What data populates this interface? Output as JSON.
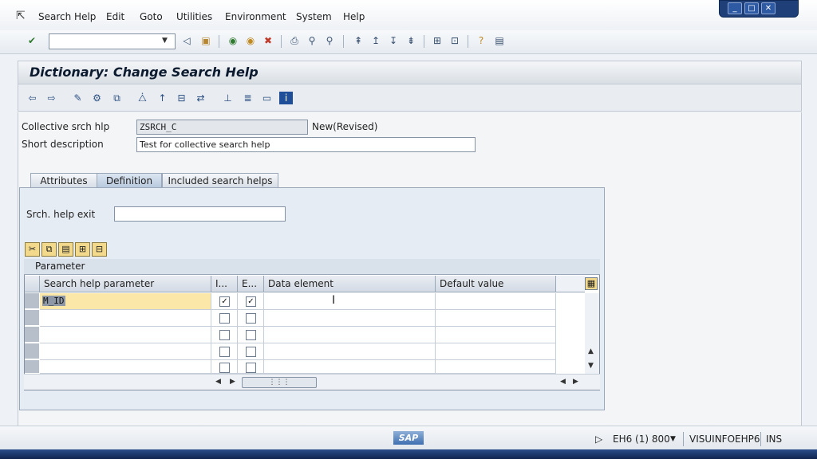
{
  "menu": {
    "items": [
      "Search Help",
      "Edit",
      "Goto",
      "Utilities",
      "Environment",
      "System",
      "Help"
    ]
  },
  "window_controls": {
    "minimize": "_",
    "maximize": "□",
    "close": "✕"
  },
  "toolbar": {
    "command_field_value": ""
  },
  "title": "Dictionary: Change Search Help",
  "form": {
    "collective_label": "Collective srch hlp",
    "collective_value": "ZSRCH_C",
    "status": "New(Revised)",
    "short_desc_label": "Short description",
    "short_desc_value": "Test for collective search help"
  },
  "tabs": [
    "Attributes",
    "Definition",
    "Included search helps"
  ],
  "definition": {
    "exit_label": "Srch. help exit",
    "exit_value": ""
  },
  "table": {
    "caption": "Parameter",
    "headers": [
      "Search help parameter",
      "I...",
      "E...",
      "Data element",
      "Default value"
    ],
    "rows": [
      {
        "param": "M_ID",
        "imp": true,
        "exp": true,
        "data_element": "",
        "default": ""
      },
      {
        "param": "",
        "imp": false,
        "exp": false,
        "data_element": "",
        "default": ""
      },
      {
        "param": "",
        "imp": false,
        "exp": false,
        "data_element": "",
        "default": ""
      },
      {
        "param": "",
        "imp": false,
        "exp": false,
        "data_element": "",
        "default": ""
      },
      {
        "param": "",
        "imp": false,
        "exp": false,
        "data_element": "",
        "default": ""
      }
    ]
  },
  "statusbar": {
    "logo": "SAP",
    "system": "EH6 (1) 800",
    "server": "VISUINFOEHP6",
    "mode": "INS"
  }
}
